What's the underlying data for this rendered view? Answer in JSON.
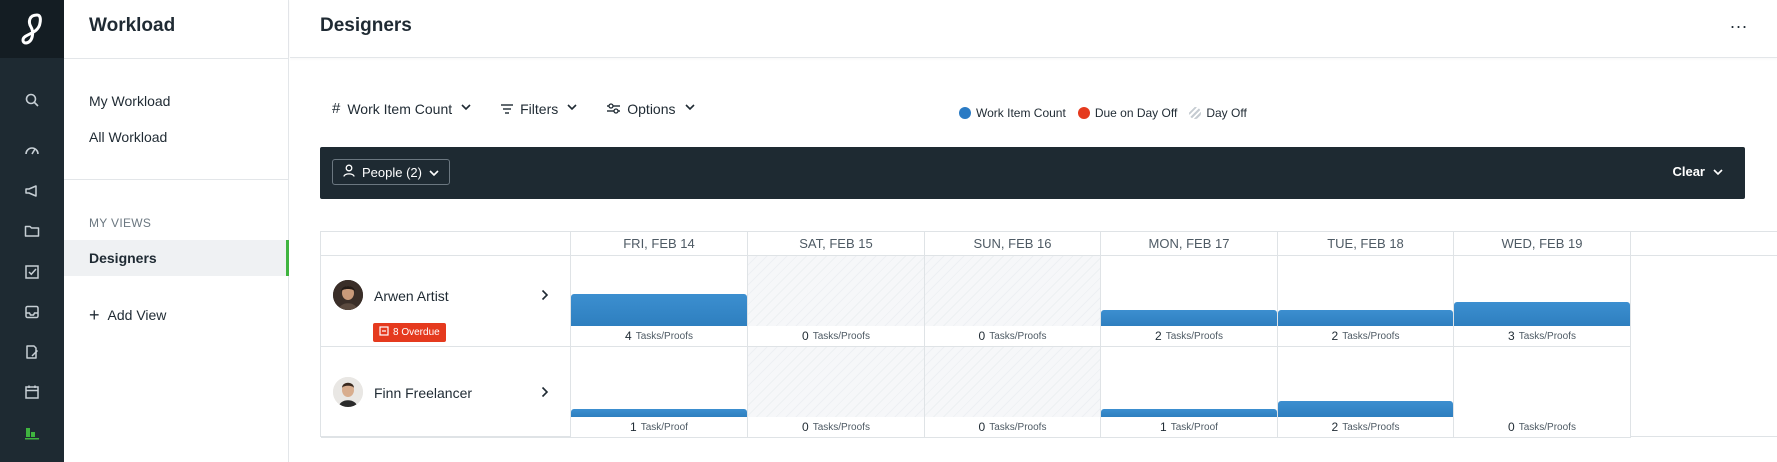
{
  "rail": {
    "icons": [
      "logo-icon",
      "search-icon",
      "dashboard-icon",
      "megaphone-icon",
      "folder-icon",
      "checkbox-icon",
      "inbox-icon",
      "proof-icon",
      "calendar-icon",
      "workload-icon"
    ]
  },
  "sidebar": {
    "title": "Workload",
    "nav": [
      {
        "label": "My Workload"
      },
      {
        "label": "All Workload"
      }
    ],
    "section_label": "MY VIEWS",
    "views": [
      {
        "label": "Designers",
        "active": true
      }
    ],
    "add_view_label": "Add View"
  },
  "header": {
    "title": "Designers",
    "more_label": "..."
  },
  "toolbar": {
    "metric_icon": "#",
    "metric_label": "Work Item Count",
    "filters_label": "Filters",
    "options_label": "Options"
  },
  "legend": [
    {
      "label": "Work Item Count",
      "color": "#2b7bc4"
    },
    {
      "label": "Due on Day Off",
      "color": "#e53a1e"
    },
    {
      "label": "Day Off",
      "color": "#c6ccd2"
    }
  ],
  "filterbar": {
    "people_label": "People (2)",
    "clear_label": "Clear"
  },
  "days": [
    "FRI, FEB 14",
    "SAT, FEB 15",
    "SUN, FEB 16",
    "MON, FEB 17",
    "TUE, FEB 18",
    "WED, FEB 19"
  ],
  "people": [
    {
      "name": "Arwen Artist",
      "overdue": "8 Overdue",
      "cells": [
        {
          "count": "4",
          "unit": "Tasks/Proofs",
          "off": false,
          "value": 4
        },
        {
          "count": "0",
          "unit": "Tasks/Proofs",
          "off": true,
          "value": 0
        },
        {
          "count": "0",
          "unit": "Tasks/Proofs",
          "off": true,
          "value": 0
        },
        {
          "count": "2",
          "unit": "Tasks/Proofs",
          "off": false,
          "value": 2
        },
        {
          "count": "2",
          "unit": "Tasks/Proofs",
          "off": false,
          "value": 2
        },
        {
          "count": "3",
          "unit": "Tasks/Proofs",
          "off": false,
          "value": 3
        }
      ]
    },
    {
      "name": "Finn Freelancer",
      "overdue": "",
      "cells": [
        {
          "count": "1",
          "unit": "Task/Proof",
          "off": false,
          "value": 1
        },
        {
          "count": "0",
          "unit": "Tasks/Proofs",
          "off": true,
          "value": 0
        },
        {
          "count": "0",
          "unit": "Tasks/Proofs",
          "off": true,
          "value": 0
        },
        {
          "count": "1",
          "unit": "Task/Proof",
          "off": false,
          "value": 1
        },
        {
          "count": "2",
          "unit": "Tasks/Proofs",
          "off": false,
          "value": 2
        },
        {
          "count": "0",
          "unit": "Tasks/Proofs",
          "off": false,
          "value": 0
        }
      ]
    }
  ],
  "colors": {
    "rail": "#1e2a32",
    "accent_green": "#3fb43f",
    "bar_blue": "#2e7fbf",
    "overdue_red": "#e53a1e"
  }
}
